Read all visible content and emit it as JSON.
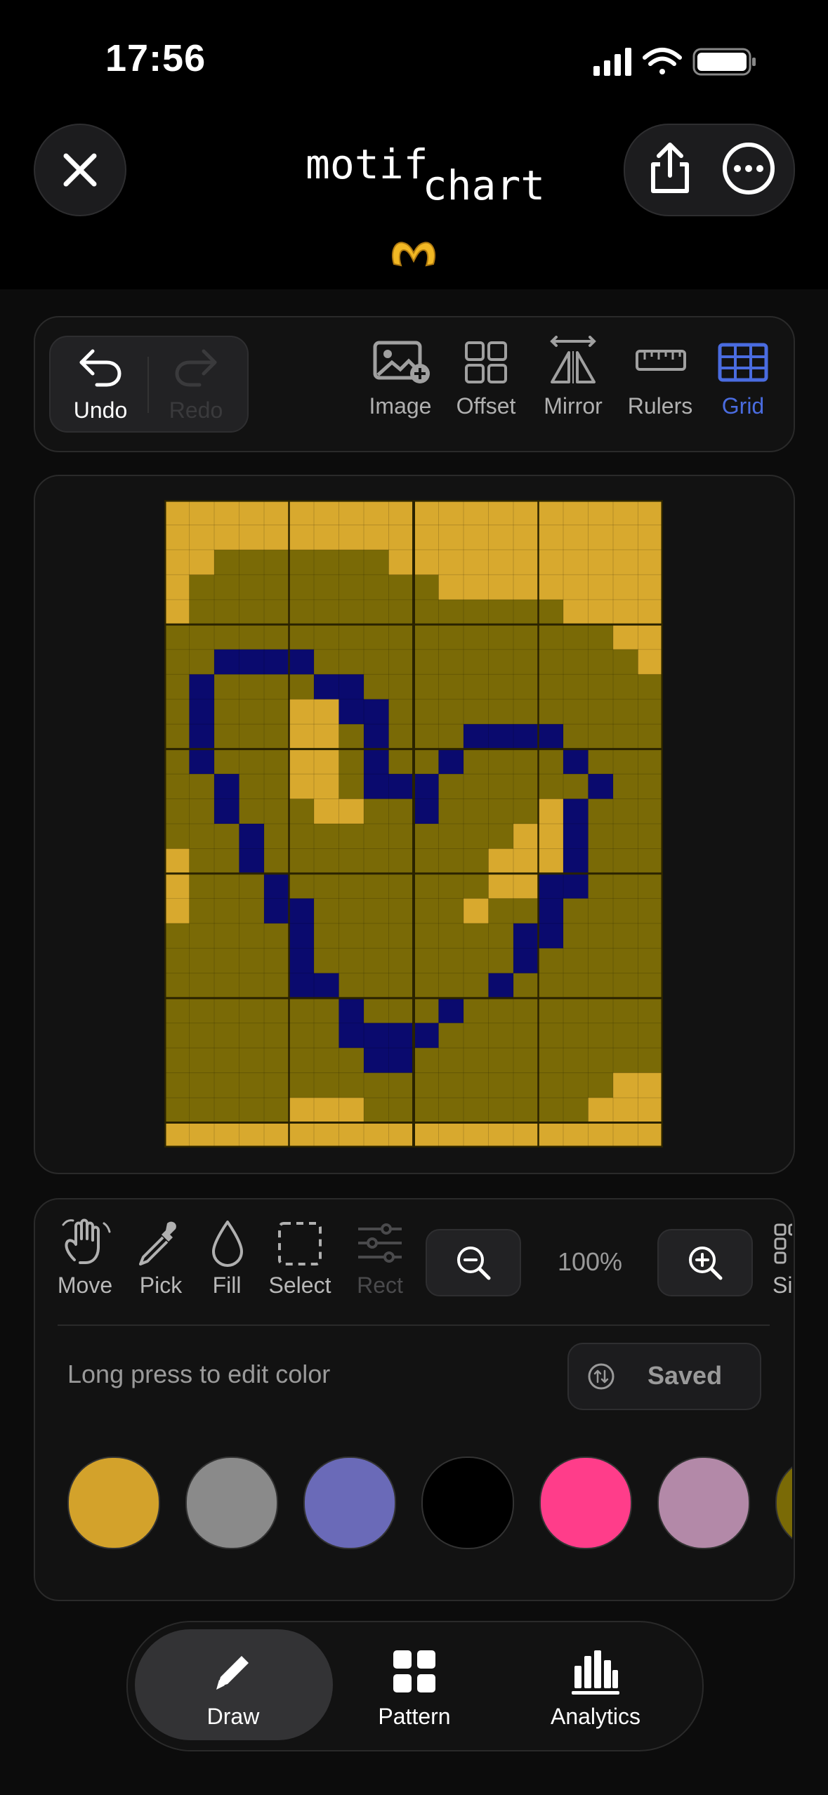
{
  "status": {
    "time": "17:56"
  },
  "header": {
    "logo_part1": "motif",
    "logo_part2": "chart"
  },
  "toolbar": {
    "undo_label": "Undo",
    "redo_label": "Redo",
    "tools": [
      {
        "label": "Image",
        "icon": "image-add-icon"
      },
      {
        "label": "Offset",
        "icon": "offset-grid-icon"
      },
      {
        "label": "Mirror",
        "icon": "mirror-icon"
      },
      {
        "label": "Rulers",
        "icon": "ruler-icon"
      },
      {
        "label": "Grid",
        "icon": "grid-icon",
        "active": true
      }
    ],
    "active_color": "#4a6ce0"
  },
  "canvas": {
    "cols": 20,
    "rows": 26,
    "palette": {
      "G": "#d8a92e",
      "O": "#7a6a06",
      "N": "#0a0a6e"
    },
    "grid_rows": [
      "GGGGGGGGGGGGGGGGGGGG",
      "GGGGGGGGGGGGGGGGGGGG",
      "GGOOOOOOOGGGGGGGGGGG",
      "GOOOOOOOOOOGGGGGGGGG",
      "GOOOOOOOOOOOOOOOGGGG",
      "OOOOOOOOOOOOOOOOOOGG",
      "OONNNNOOOOOOOOOOOOOG",
      "ONOOOONNOOOOOOOOOOOO",
      "ONOOOGGNNOOOOOOOOOOO",
      "ONOOOGGONOOONNNNOOOO",
      "ONOOOGGONOONOOOONOOO",
      "OONOOGGONNNOOOOOONOO",
      "OONOOOGGOONOOOOGNOOO",
      "OOONOOOOOOOOOOGGNOOO",
      "GOONOOOOOOOOOGGGNOOO",
      "GOOONOOOOOOOOGGNNOOO",
      "GOOONNOOOOOOGOONOOOO",
      "OOOOONOOOOOOOONNOOOO",
      "OOOOONOOOOOOOONOOOOO",
      "OOOOONNOOOOOONOOOOOO",
      "OOOOOOONOOONOOOOOOOO",
      "OOOOOOONNNNOOOOOOOOO",
      "OOOOOOOONNOOOOOOOOOO",
      "OOOOOOOOOOOOOOOOOOGG",
      "OOOOOGGGOOOOOOOOOGGG",
      "GGGGGGGGGGGGGGGGGGGG"
    ]
  },
  "tools": {
    "items": [
      {
        "label": "Move",
        "icon": "hand-icon"
      },
      {
        "label": "Pick",
        "icon": "eyedropper-icon"
      },
      {
        "label": "Fill",
        "icon": "drop-icon"
      },
      {
        "label": "Select",
        "icon": "select-icon"
      },
      {
        "label": "Rect",
        "icon": "sliders-icon",
        "disabled": true
      }
    ],
    "zoom_value": "100%",
    "partial_label": "Si",
    "hint": "Long press to edit color",
    "saved_label": "Saved"
  },
  "swatches": [
    "#d3a22b",
    "#8a8a8a",
    "#6a6ab8",
    "#000000",
    "#ff3d8a",
    "#b389a8",
    "#7a6a06"
  ],
  "nav": {
    "items": [
      {
        "label": "Draw",
        "icon": "pencil-icon",
        "active": true
      },
      {
        "label": "Pattern",
        "icon": "pattern-icon"
      },
      {
        "label": "Analytics",
        "icon": "bar-chart-icon"
      }
    ]
  }
}
